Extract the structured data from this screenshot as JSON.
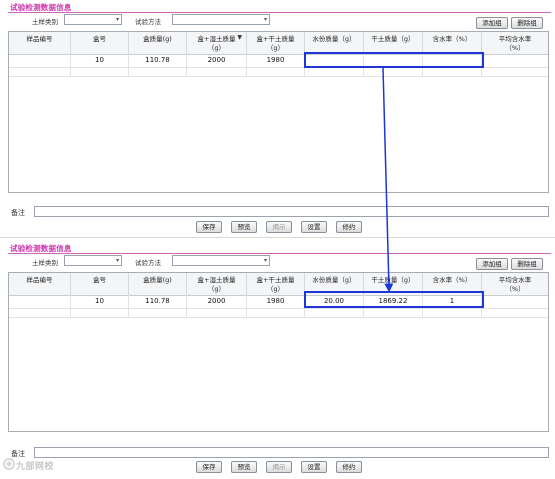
{
  "section_title": "试验检测数据信息",
  "soil_type_label": "土样类别",
  "soil_type_value": "",
  "test_method_label": "试验方法",
  "test_method_value": "",
  "add_group_label": "添加组",
  "delete_group_label": "删除组",
  "columns": [
    "样品编号",
    "盒号",
    "盒质量(g)",
    "盒+湿土质量\n（g）",
    "盒+干土质量\n（g）",
    "水份质量（g）",
    "干土质量（g）",
    "含水率（%）",
    "平均含水率\n（%）"
  ],
  "before_row": [
    "",
    "10",
    "110.78",
    "2000",
    "1980",
    "",
    "",
    "",
    ""
  ],
  "after_row": [
    "",
    "10",
    "110.78",
    "2000",
    "1980",
    "20.00",
    "1869.22",
    "1",
    ""
  ],
  "notes_label": "备注",
  "buttons": {
    "save": "保存",
    "preview": "预览",
    "show": "揭示",
    "settings": "设置",
    "revise": "修约"
  },
  "watermark": "九部网校",
  "colors": {
    "title": "#cc33aa",
    "highlight": "#1c37d6"
  }
}
